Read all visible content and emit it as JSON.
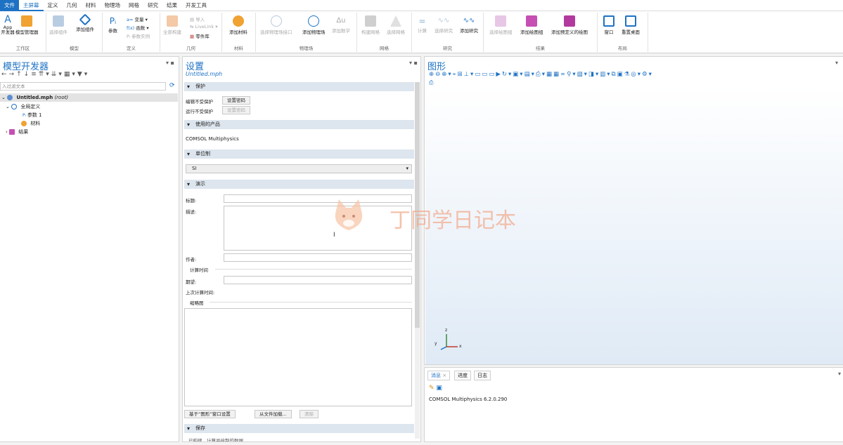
{
  "menu": [
    "文件",
    "主屏幕",
    "定义",
    "几何",
    "材料",
    "物理场",
    "网格",
    "研究",
    "结果",
    "开发工具"
  ],
  "ribbon": {
    "groups": [
      {
        "label": "工作区"
      },
      {
        "label": "模型"
      },
      {
        "label": "定义"
      },
      {
        "label": "几何"
      },
      {
        "label": "材料"
      },
      {
        "label": "物理场"
      },
      {
        "label": "网格"
      },
      {
        "label": "研究"
      },
      {
        "label": "结果"
      },
      {
        "label": "布局"
      }
    ],
    "app_dev": [
      "App",
      "开发器"
    ],
    "model_manager": "模型管理器",
    "select_component": "选择组件",
    "add_component": "添加组件",
    "parameters": "参数",
    "variables": "变量",
    "functions": "函数",
    "param_case": "参数实例",
    "build_all": "全部构建",
    "import": "导入",
    "livelink": "LiveLink",
    "part_library": "零件库",
    "add_material": "添加材料",
    "select_phys_iface": "选择物理场接口",
    "add_physics": "添加物理场",
    "add_math": "添加数学",
    "build_mesh": "构建网格",
    "select_mesh": "选择网格",
    "compute": "计算",
    "select_study": "选择研究",
    "add_study": "添加研究",
    "select_plot_group": "选择绘图组",
    "add_plot_group": "添加绘图组",
    "add_predefined_plot": "添加预定义的绘图",
    "window": "窗口",
    "reset_desktop": "重置桌面"
  },
  "left": {
    "title": "模型开发器",
    "filter_placeholder": "入过滤文本",
    "tree": {
      "root_name": "Untitled.mph",
      "root_tag": "(root)",
      "global_defs": "全局定义",
      "params": "参数 1",
      "materials": "材料",
      "results": "结果"
    }
  },
  "settings": {
    "title": "设置",
    "subtitle": "Untitled.mph",
    "protection": "保护",
    "edit_protect": "编辑不受保护",
    "run_protect": "运行不受保护",
    "set_pwd": "设置密码",
    "set_pwd2": "设置密码",
    "products_used": "使用的产品",
    "product_name": "COMSOL Multiphysics",
    "unit_system": "单位制",
    "unit_value": "SI",
    "presentation": "演示",
    "title_label": "标题:",
    "desc_label": "描述:",
    "author_label": "作者:",
    "compute_time": "计算时间",
    "expected_label": "期望:",
    "last_compute_label": "上次计算时间:",
    "thumbnail": "缩略图",
    "from_graphics_btn": "基于“图形”窗口设置",
    "from_file_btn": "从文件加载...",
    "clear_btn": "清除",
    "save": "保存",
    "save_opt": "已构建、计算并绘制的数据"
  },
  "graphics": {
    "title": "图形",
    "axis_x": "x",
    "axis_y": "y",
    "axis_z": "z"
  },
  "messages": {
    "tabs": [
      "消息",
      "进度",
      "日志"
    ],
    "close": "×",
    "text": "COMSOL Multiphysics 6.2.0.290"
  },
  "watermark": "丁同学日记本",
  "colors": {
    "accent": "#1e72c4",
    "section_bg": "#dde5ee",
    "canvas_top": "#ffffff",
    "canvas_bottom": "#dfeaf6"
  }
}
